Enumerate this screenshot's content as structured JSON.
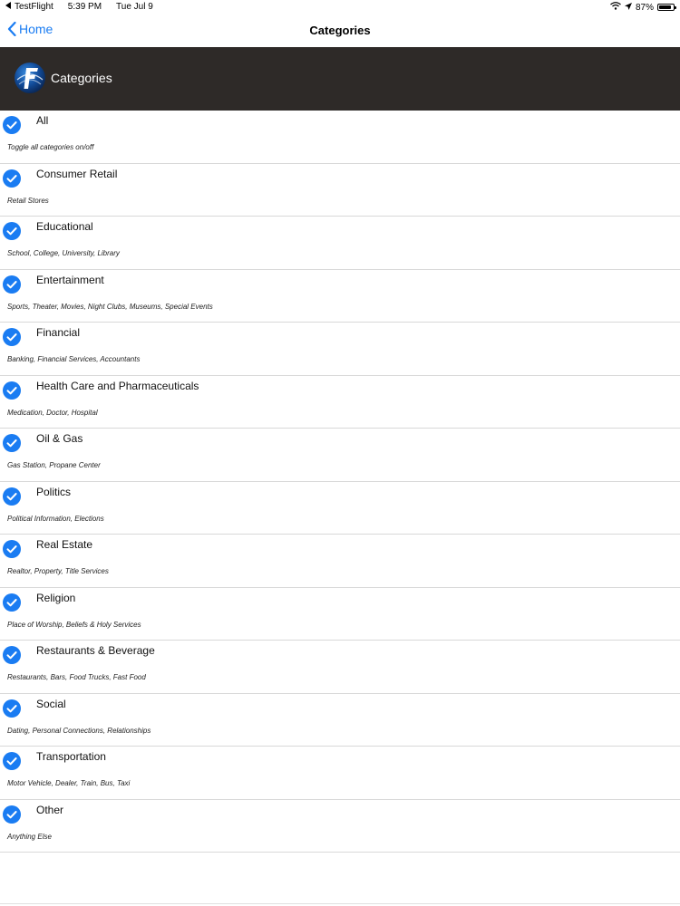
{
  "status_bar": {
    "back_app": "TestFlight",
    "time": "5:39 PM",
    "date": "Tue Jul 9",
    "battery_text": "87%",
    "battery_level": 0.87,
    "icons": [
      "back-triangle-icon",
      "wifi-icon",
      "location-icon",
      "battery-icon"
    ]
  },
  "nav": {
    "back_label": "Home",
    "title": "Categories"
  },
  "header": {
    "title": "Categories",
    "logo_icon": "app-logo-icon",
    "background": "#2e2a28"
  },
  "accent_color": "#1a7cf2",
  "categories": [
    {
      "name": "All",
      "description": "Toggle all categories on/off",
      "checked": true
    },
    {
      "name": "Consumer Retail",
      "description": "Retail Stores",
      "checked": true
    },
    {
      "name": "Educational",
      "description": "School, College, University, Library",
      "checked": true
    },
    {
      "name": "Entertainment",
      "description": "Sports, Theater, Movies, Night Clubs, Museums, Special Events",
      "checked": true
    },
    {
      "name": "Financial",
      "description": "Banking, Financial Services, Accountants",
      "checked": true
    },
    {
      "name": "Health Care and Pharmaceuticals",
      "description": "Medication, Doctor, Hospital",
      "checked": true
    },
    {
      "name": "Oil & Gas",
      "description": "Gas Station, Propane Center",
      "checked": true
    },
    {
      "name": "Politics",
      "description": "Political Information, Elections",
      "checked": true
    },
    {
      "name": "Real Estate",
      "description": "Realtor, Property, Title Services",
      "checked": true
    },
    {
      "name": "Religion",
      "description": "Place of Worship, Beliefs & Holy Services",
      "checked": true
    },
    {
      "name": "Restaurants & Beverage",
      "description": "Restaurants, Bars, Food Trucks, Fast Food",
      "checked": true
    },
    {
      "name": "Social",
      "description": "Dating, Personal Connections, Relationships",
      "checked": true
    },
    {
      "name": "Transportation",
      "description": "Motor Vehicle, Dealer, Train, Bus, Taxi",
      "checked": true
    },
    {
      "name": "Other",
      "description": "Anything Else",
      "checked": true
    }
  ]
}
